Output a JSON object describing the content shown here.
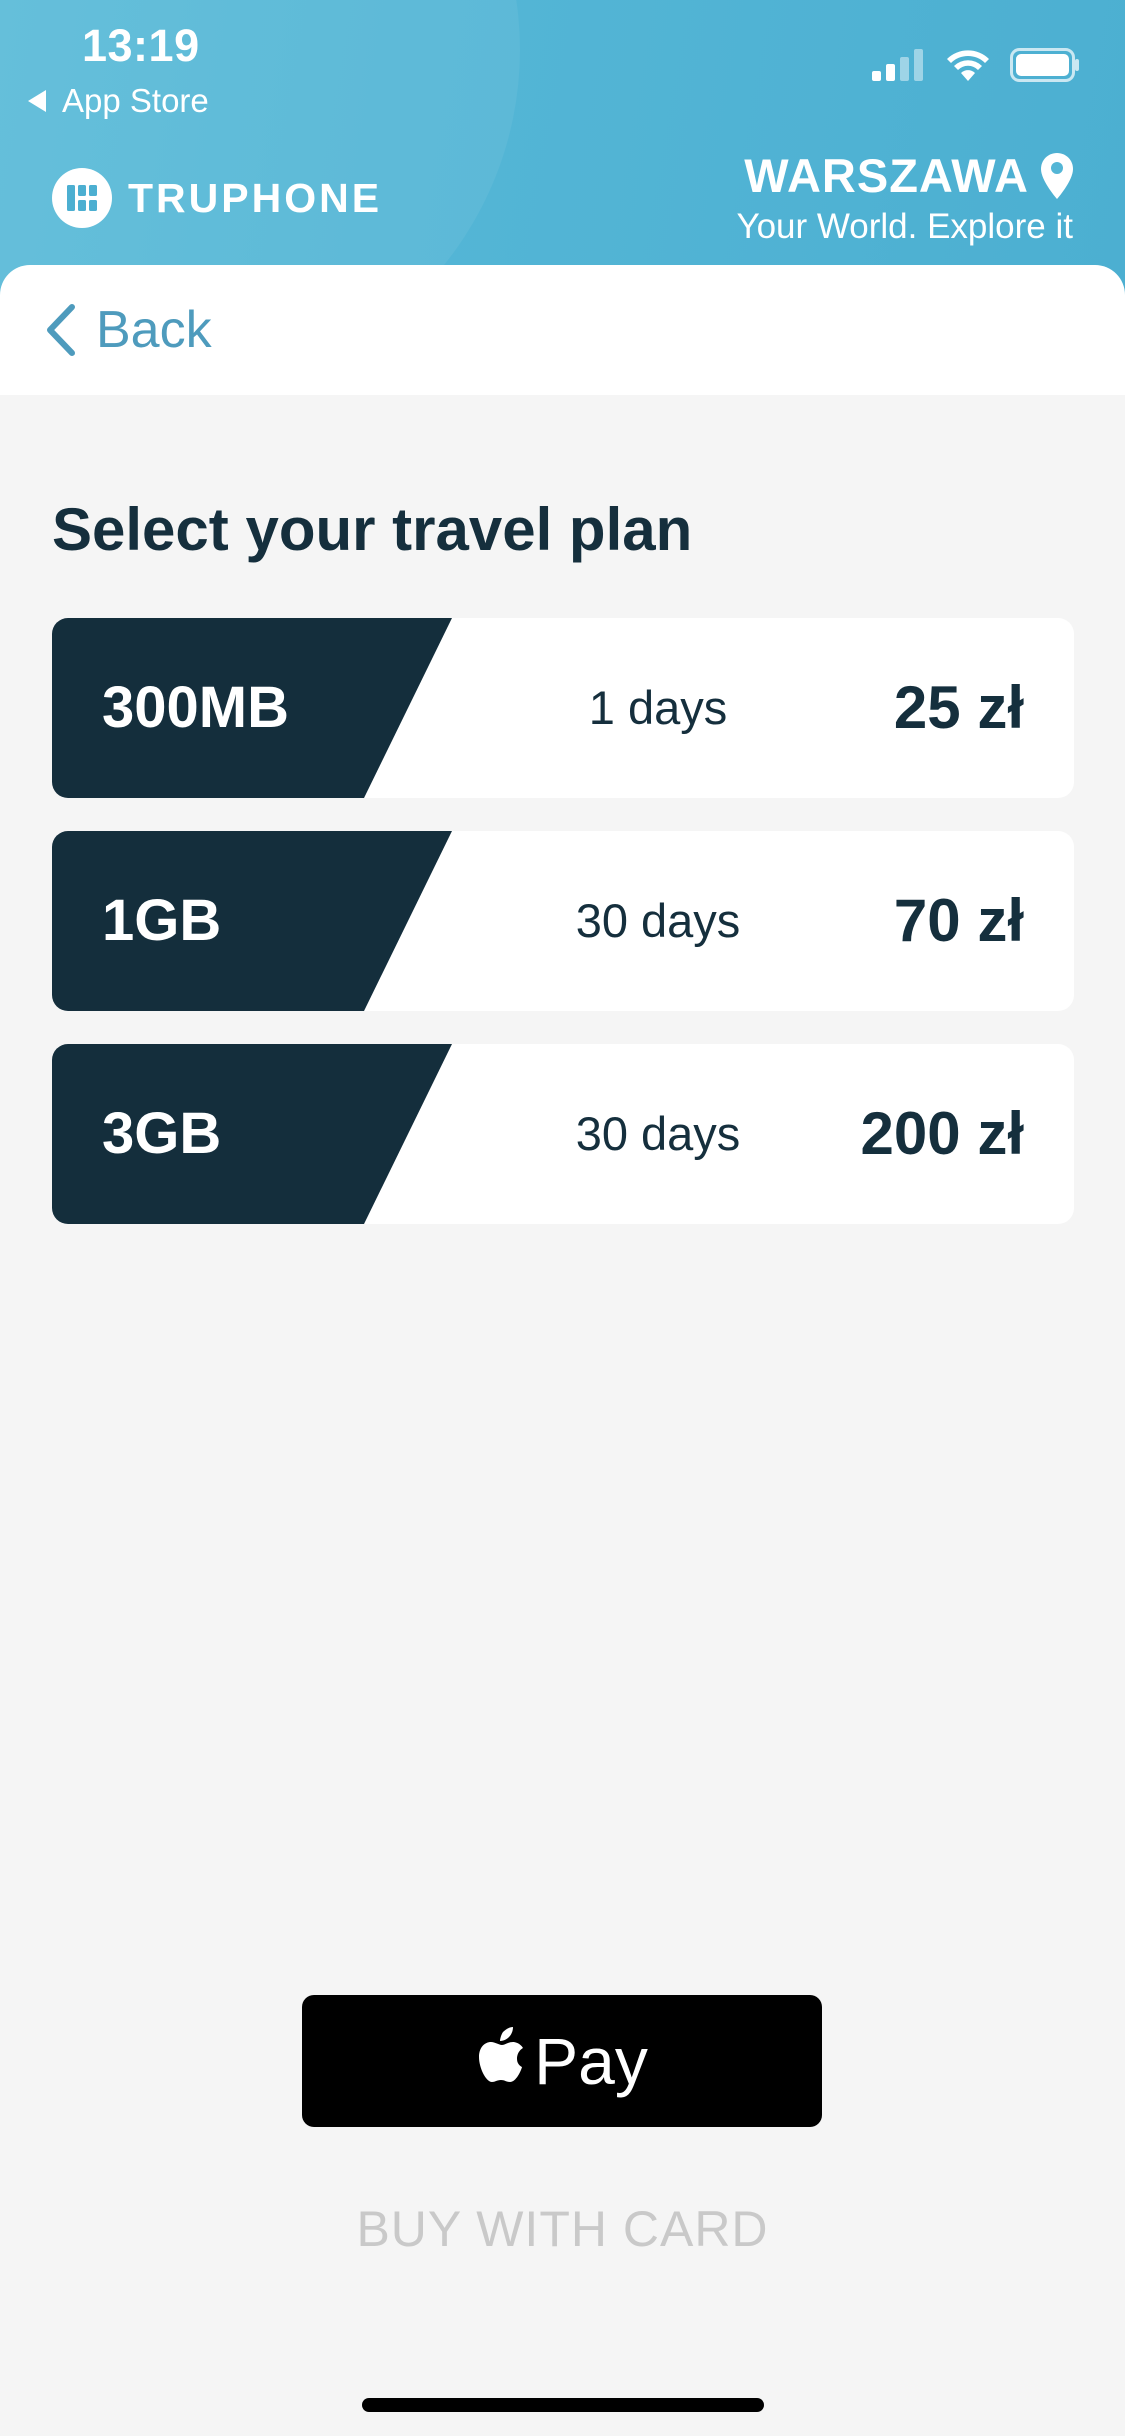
{
  "status_bar": {
    "time": "13:19",
    "back_app_label": "App Store",
    "icons": [
      "signal-icon",
      "wifi-icon",
      "battery-icon"
    ]
  },
  "header": {
    "brand_name": "TRUPHONE",
    "city": "WARSZAWA",
    "tagline": "Your World. Explore it"
  },
  "nav": {
    "back_label": "Back"
  },
  "main": {
    "title": "Select your travel plan",
    "plans": [
      {
        "data": "300MB",
        "duration": "1 days",
        "price": "25 zł"
      },
      {
        "data": "1GB",
        "duration": "30 days",
        "price": "70 zł"
      },
      {
        "data": "3GB",
        "duration": "30 days",
        "price": "200 zł"
      }
    ]
  },
  "actions": {
    "apple_pay_label": "Pay",
    "buy_card_label": "BUY WITH CARD"
  },
  "colors": {
    "header_bg": "#54b6d6",
    "accent": "#4e9bbd",
    "plan_badge": "#142e3c",
    "text_dark": "#152f3d",
    "disabled_text": "#c9c9c9"
  }
}
